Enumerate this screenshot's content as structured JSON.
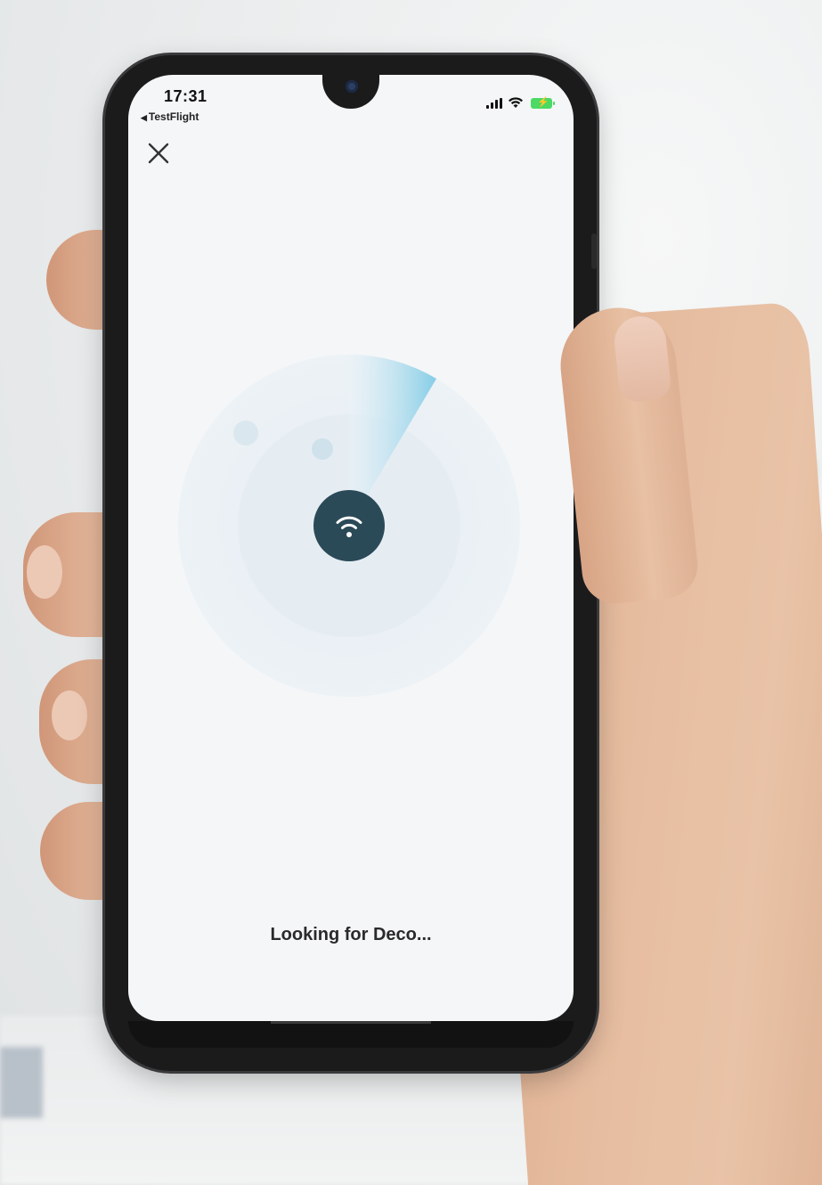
{
  "status_bar": {
    "time": "17:31",
    "back_app": "TestFlight",
    "battery_bolt": "⚡"
  },
  "screen": {
    "close_icon": "close-icon",
    "center_icon": "wifi-icon",
    "message": "Looking for Deco..."
  },
  "colors": {
    "screen_bg": "#f4f6f8",
    "hub": "#2b4a58",
    "sweep": "#7fcbe6",
    "battery": "#4cd964"
  }
}
